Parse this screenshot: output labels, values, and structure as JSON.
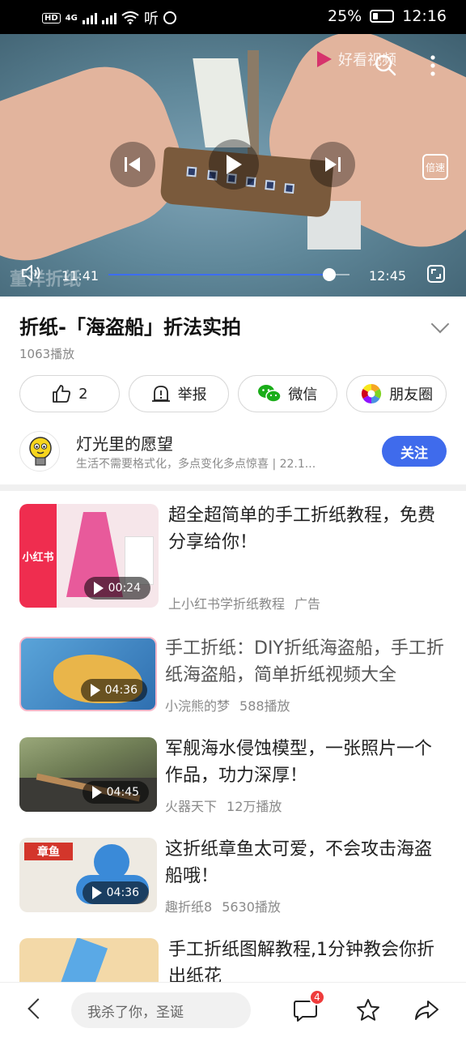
{
  "status_bar": {
    "hd_badge": "HD",
    "network": "4G",
    "left_extra": "听",
    "battery": "25%",
    "time": "12:16"
  },
  "video": {
    "brand": "好看视频",
    "watermark": "董洋折纸",
    "current_time": "11:41",
    "duration": "12:45",
    "progress_fraction": 0.916,
    "speed_label": "倍速"
  },
  "info": {
    "title": "折纸-「海盗船」折法实拍",
    "plays": "1063播放"
  },
  "actions": [
    {
      "label": "2",
      "icon": "thumbs-up-icon"
    },
    {
      "label": "举报",
      "icon": "report-icon"
    },
    {
      "label": "微信",
      "icon": "wechat-icon"
    },
    {
      "label": "朋友圈",
      "icon": "moments-icon"
    }
  ],
  "author": {
    "name": "灯光里的愿望",
    "desc": "生活不需要格式化，多点变化多点惊喜 | 22.1...",
    "follow": "关注"
  },
  "feed": [
    {
      "title": "超全超简单的手工折纸教程，免费分享给你！",
      "source": "上小红书学折纸教程",
      "tag": "广告",
      "duration": "00:24",
      "thumb_label": "小红书"
    },
    {
      "title": "手工折纸：DIY折纸海盗船，手工折纸海盗船，简单折纸视频大全",
      "source": "小浣熊的梦",
      "tag": "588播放",
      "duration": "04:36"
    },
    {
      "title": "军舰海水侵蚀模型，一张照片一个作品，功力深厚！",
      "source": "火器天下",
      "tag": "12万播放",
      "duration": "04:45"
    },
    {
      "title": "这折纸章鱼太可爱，不会攻击海盗船哦！",
      "source": "趣折纸8",
      "tag": "5630播放",
      "duration": "04:36",
      "thumb_label": "章鱼"
    },
    {
      "title": "手工折纸图解教程,1分钟教会你折出纸花"
    }
  ],
  "bottom_bar": {
    "comment_placeholder": "我杀了你，圣诞",
    "comment_count": "4"
  },
  "colors": {
    "accent": "#3f6bec",
    "badge": "#ef3b3b"
  }
}
